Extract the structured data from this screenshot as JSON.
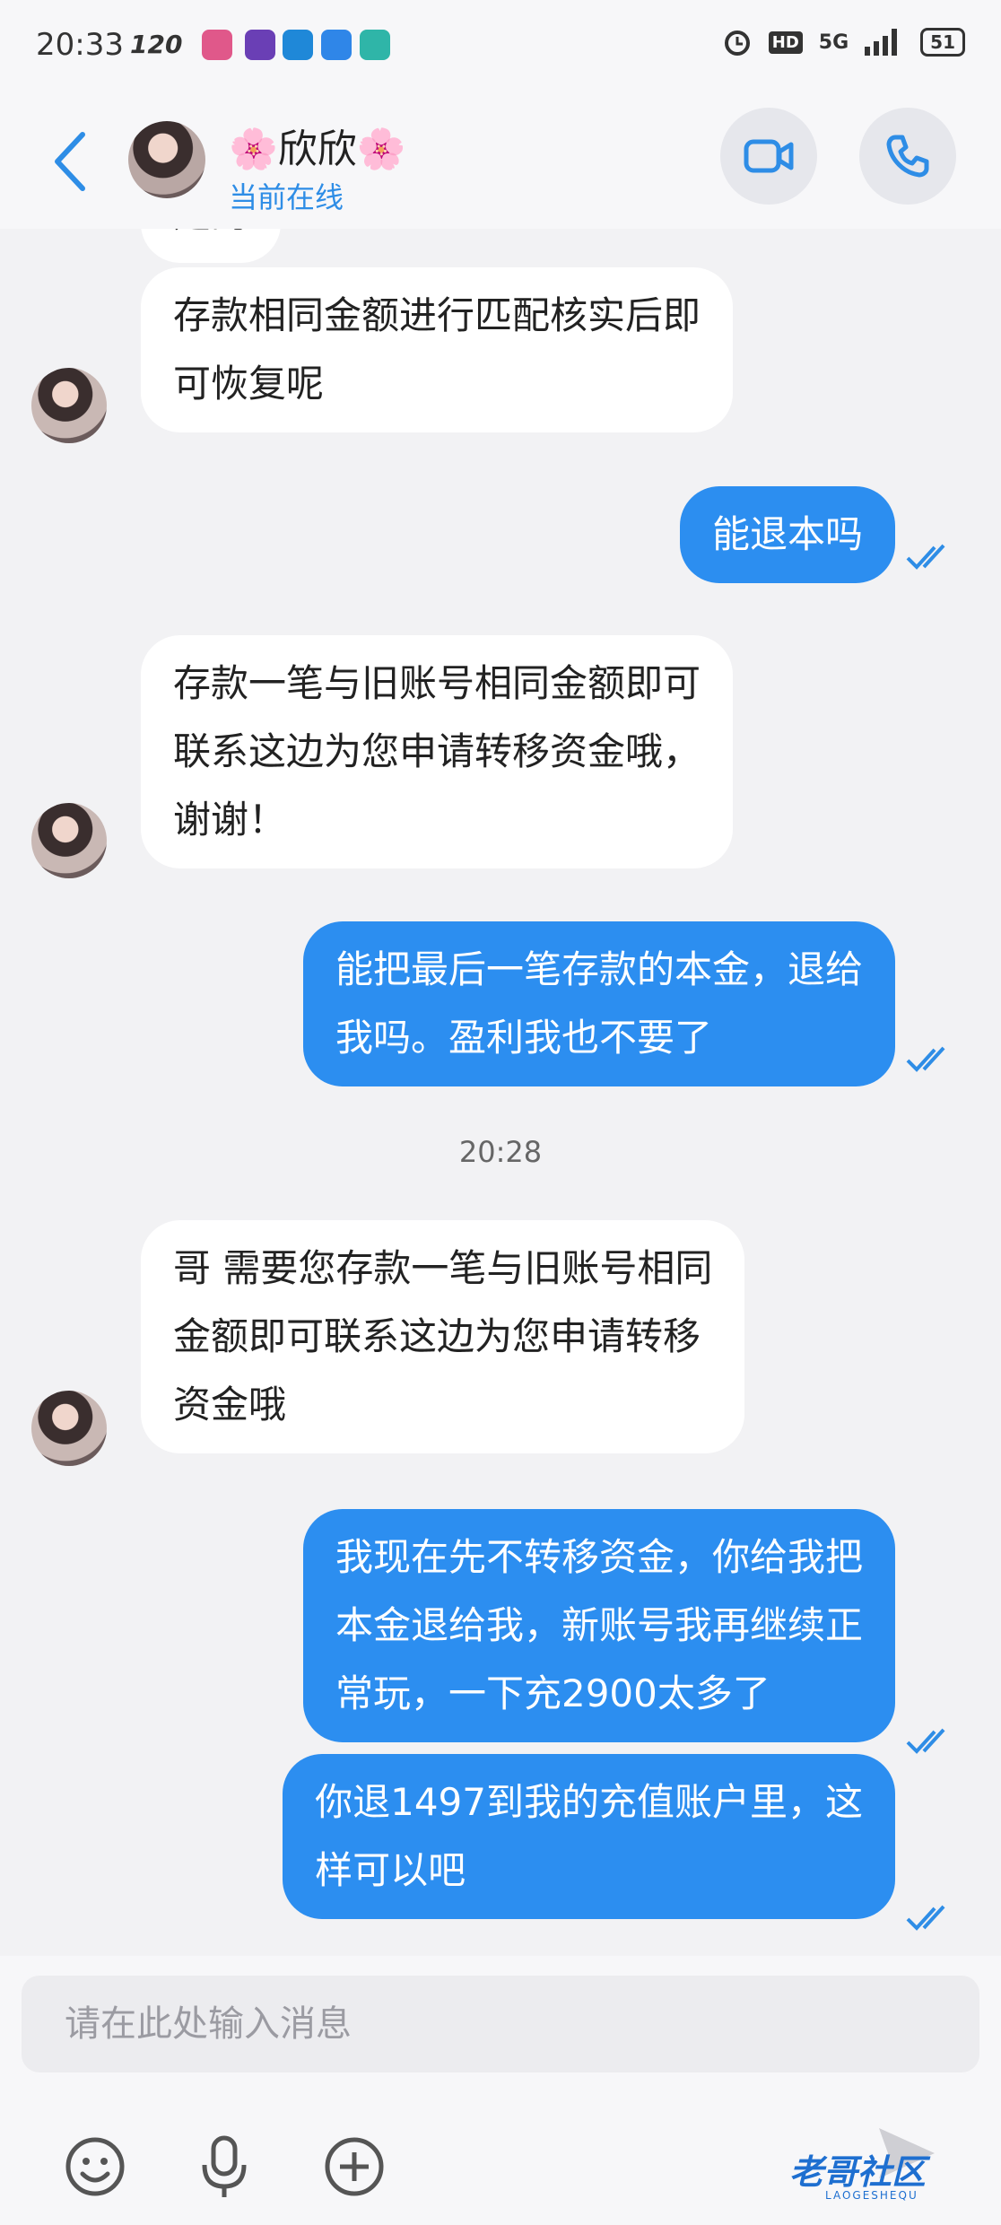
{
  "status_bar": {
    "time": "20:33",
    "refresh": "120",
    "network": "5G",
    "hd": "HD",
    "battery": "51"
  },
  "header": {
    "contact_name": "🌸欣欣🌸",
    "contact_status": "当前在线"
  },
  "messages": [
    {
      "id": "m0",
      "side": "in",
      "text": "是的"
    },
    {
      "id": "m1",
      "side": "in",
      "text": "存款相同金额进行匹配核实后即\n可恢复呢"
    },
    {
      "id": "m2",
      "side": "out",
      "text": "能退本吗"
    },
    {
      "id": "m3",
      "side": "in",
      "text": "存款一笔与旧账号相同金额即可\n联系这边为您申请转移资金哦，\n谢谢！"
    },
    {
      "id": "m4",
      "side": "out",
      "text": "能把最后一笔存款的本金，退给\n我吗。盈利我也不要了"
    },
    {
      "id": "m5",
      "side": "in",
      "text": "哥 需要您存款一笔与旧账号相同\n金额即可联系这边为您申请转移\n资金哦"
    },
    {
      "id": "m6",
      "side": "out",
      "text": "我现在先不转移资金，你给我把\n本金退给我，新账号我再继续正\n常玩，一下充2900太多了"
    },
    {
      "id": "m7",
      "side": "out",
      "text": "你退1497到我的充值账户里，这\n样可以吧"
    }
  ],
  "timestamp_divider": "20:28",
  "composer": {
    "placeholder": "请在此处输入消息"
  },
  "watermark": {
    "title": "老哥社区",
    "subtitle": "LAOGESHEQU"
  },
  "colors": {
    "accent": "#2c8ef0",
    "background": "#f2f2f4"
  }
}
